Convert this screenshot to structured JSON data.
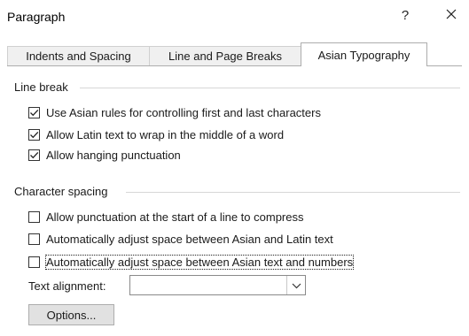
{
  "window": {
    "title": "Paragraph",
    "help_label": "?",
    "close_icon": "close-icon"
  },
  "tabs": [
    {
      "label": "Indents and Spacing",
      "active": false
    },
    {
      "label": "Line and Page Breaks",
      "active": false
    },
    {
      "label": "Asian Typography",
      "active": true
    }
  ],
  "line_break": {
    "label": "Line break",
    "options": [
      {
        "label": "Use Asian rules for controlling first and last characters",
        "checked": true
      },
      {
        "label": "Allow Latin text to wrap in the middle of a word",
        "checked": true
      },
      {
        "label": "Allow hanging punctuation",
        "checked": true
      }
    ]
  },
  "character_spacing": {
    "label": "Character spacing",
    "options": [
      {
        "label": "Allow punctuation at the start of a line to compress",
        "checked": false
      },
      {
        "label": "Automatically adjust space between Asian and Latin text",
        "checked": false
      },
      {
        "label": "Automatically adjust space between Asian text and numbers",
        "checked": false,
        "focused": true
      }
    ]
  },
  "text_alignment": {
    "label": "Text alignment:",
    "value": "",
    "arrow_icon": "chevron-down-icon"
  },
  "options_button": {
    "label": "Options..."
  },
  "colors": {
    "tab_border": "#adadad",
    "inactive_tab_bg": "#f0f0f0",
    "button_bg": "#e1e1e1",
    "group_rule": "#d6d6d6"
  }
}
